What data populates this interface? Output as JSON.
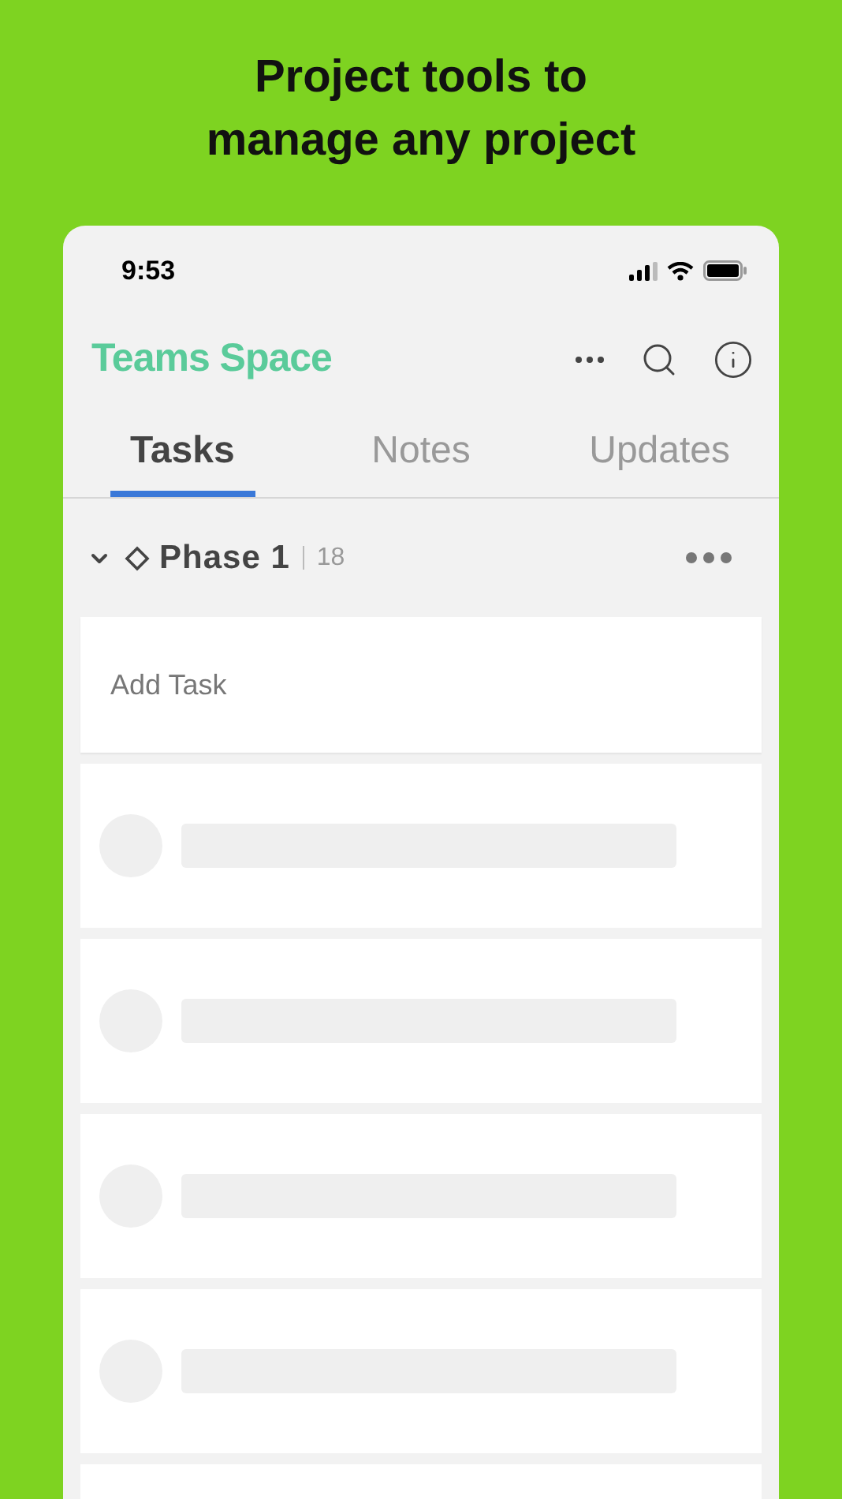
{
  "headline": "Project tools to manage any project",
  "status_bar": {
    "time": "9:53"
  },
  "header": {
    "title": "Teams Space"
  },
  "tabs": [
    {
      "label": "Tasks",
      "selected": true
    },
    {
      "label": "Notes",
      "selected": false
    },
    {
      "label": "Updates",
      "selected": false
    }
  ],
  "section": {
    "title": "Phase 1",
    "count": "18",
    "expanded": true
  },
  "add_task": {
    "placeholder": "Add Task"
  },
  "rows": [
    {
      "kind": "skeleton"
    },
    {
      "kind": "skeleton"
    },
    {
      "kind": "skeleton"
    },
    {
      "kind": "skeleton"
    },
    {
      "kind": "edge"
    }
  ]
}
